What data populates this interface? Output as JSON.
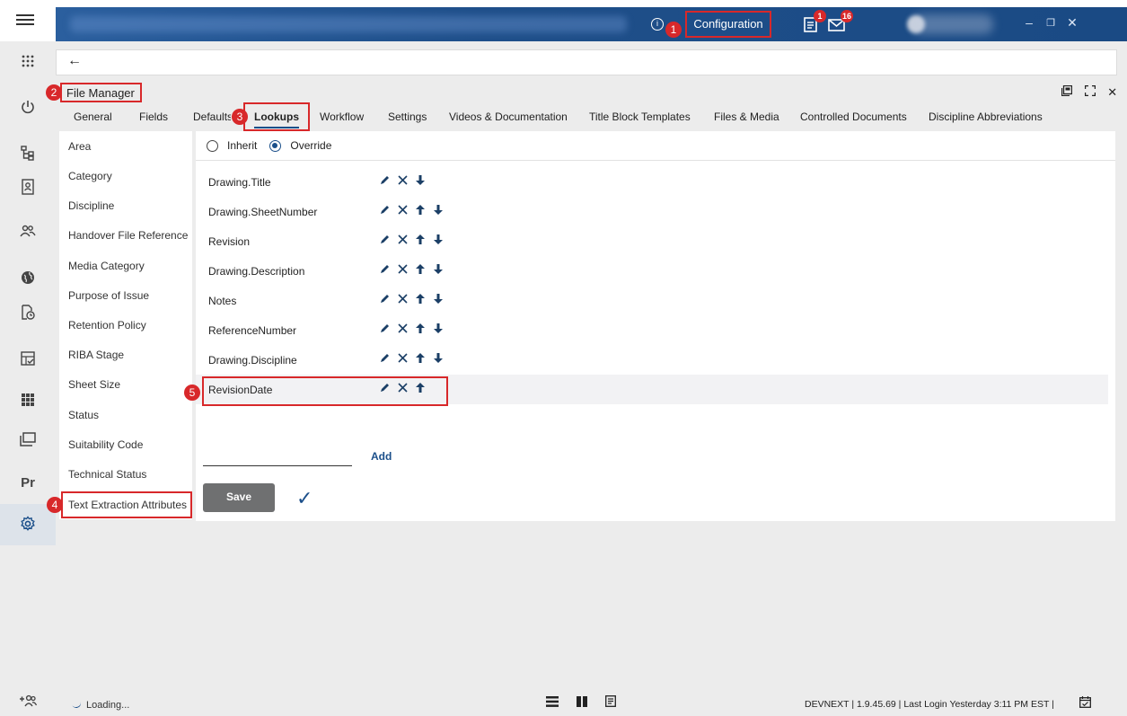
{
  "header": {
    "config_label": "Configuration",
    "tasks_badge": "1",
    "messages_badge": "16"
  },
  "panel": {
    "title": "File Manager"
  },
  "tabs": [
    {
      "label": "General"
    },
    {
      "label": "Fields"
    },
    {
      "label": "Defaults"
    },
    {
      "label": "Lookups",
      "active": true
    },
    {
      "label": "Workflow"
    },
    {
      "label": "Settings"
    },
    {
      "label": "Videos & Documentation"
    },
    {
      "label": "Title Block Templates"
    },
    {
      "label": "Files & Media"
    },
    {
      "label": "Controlled Documents"
    },
    {
      "label": "Discipline Abbreviations"
    }
  ],
  "categories": [
    "Area",
    "Category",
    "Discipline",
    "Handover File Reference",
    "Media Category",
    "Purpose of Issue",
    "Retention Policy",
    "RIBA Stage",
    "Sheet Size",
    "Status",
    "Suitability Code",
    "Technical Status",
    "Text Extraction Attributes"
  ],
  "mode": {
    "inherit_label": "Inherit",
    "override_label": "Override",
    "selected": "Override"
  },
  "fields": [
    {
      "name": "Drawing.Title",
      "up": false,
      "down": true
    },
    {
      "name": "Drawing.SheetNumber",
      "up": true,
      "down": true
    },
    {
      "name": "Revision",
      "up": true,
      "down": true
    },
    {
      "name": "Drawing.Description",
      "up": true,
      "down": true
    },
    {
      "name": "Notes",
      "up": true,
      "down": true
    },
    {
      "name": "ReferenceNumber",
      "up": true,
      "down": true
    },
    {
      "name": "Drawing.Discipline",
      "up": true,
      "down": true
    },
    {
      "name": "RevisionDate",
      "up": true,
      "down": false
    }
  ],
  "form": {
    "add_label": "Add",
    "save_label": "Save"
  },
  "status": {
    "loading": "Loading...",
    "info": "DEVNEXT  |  1.9.45.69  |  Last Login Yesterday 3:11 PM EST  |"
  },
  "rail": {
    "pr_label": "Pr"
  },
  "markers": [
    "1",
    "2",
    "3",
    "4",
    "5"
  ],
  "colors": {
    "header_blue": "#1f4f8a",
    "highlight_red": "#d8282a",
    "action_blue": "#1b3f66",
    "save_grey": "#6f7071"
  }
}
